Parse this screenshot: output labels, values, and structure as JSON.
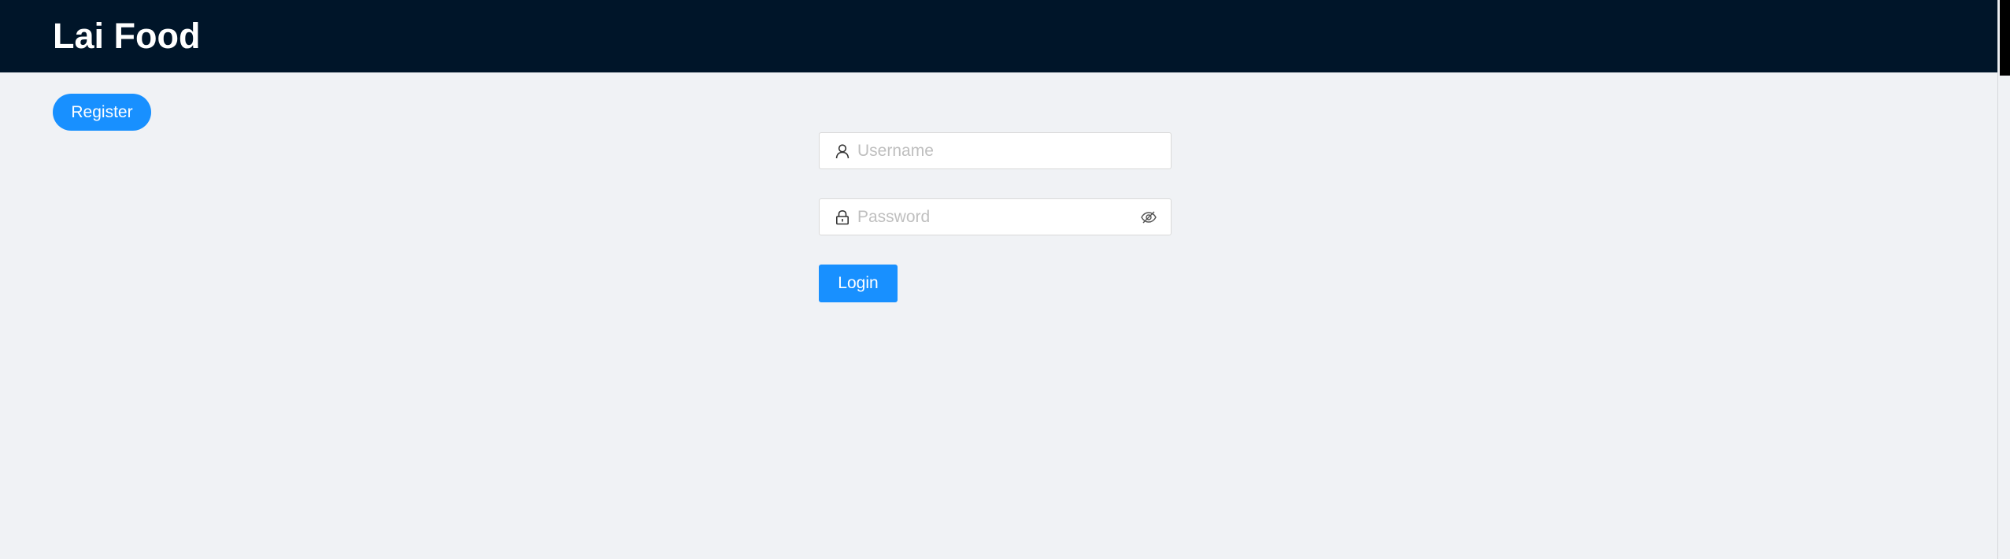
{
  "header": {
    "title": "Lai Food"
  },
  "actions": {
    "register_label": "Register"
  },
  "login_form": {
    "username_placeholder": "Username",
    "password_placeholder": "Password",
    "login_label": "Login",
    "username_icon": "user-icon",
    "password_icon": "lock-icon",
    "visibility_icon": "eye-invisible-icon"
  },
  "colors": {
    "header_bg": "#001529",
    "primary": "#1890ff",
    "page_bg": "#f0f2f5"
  }
}
